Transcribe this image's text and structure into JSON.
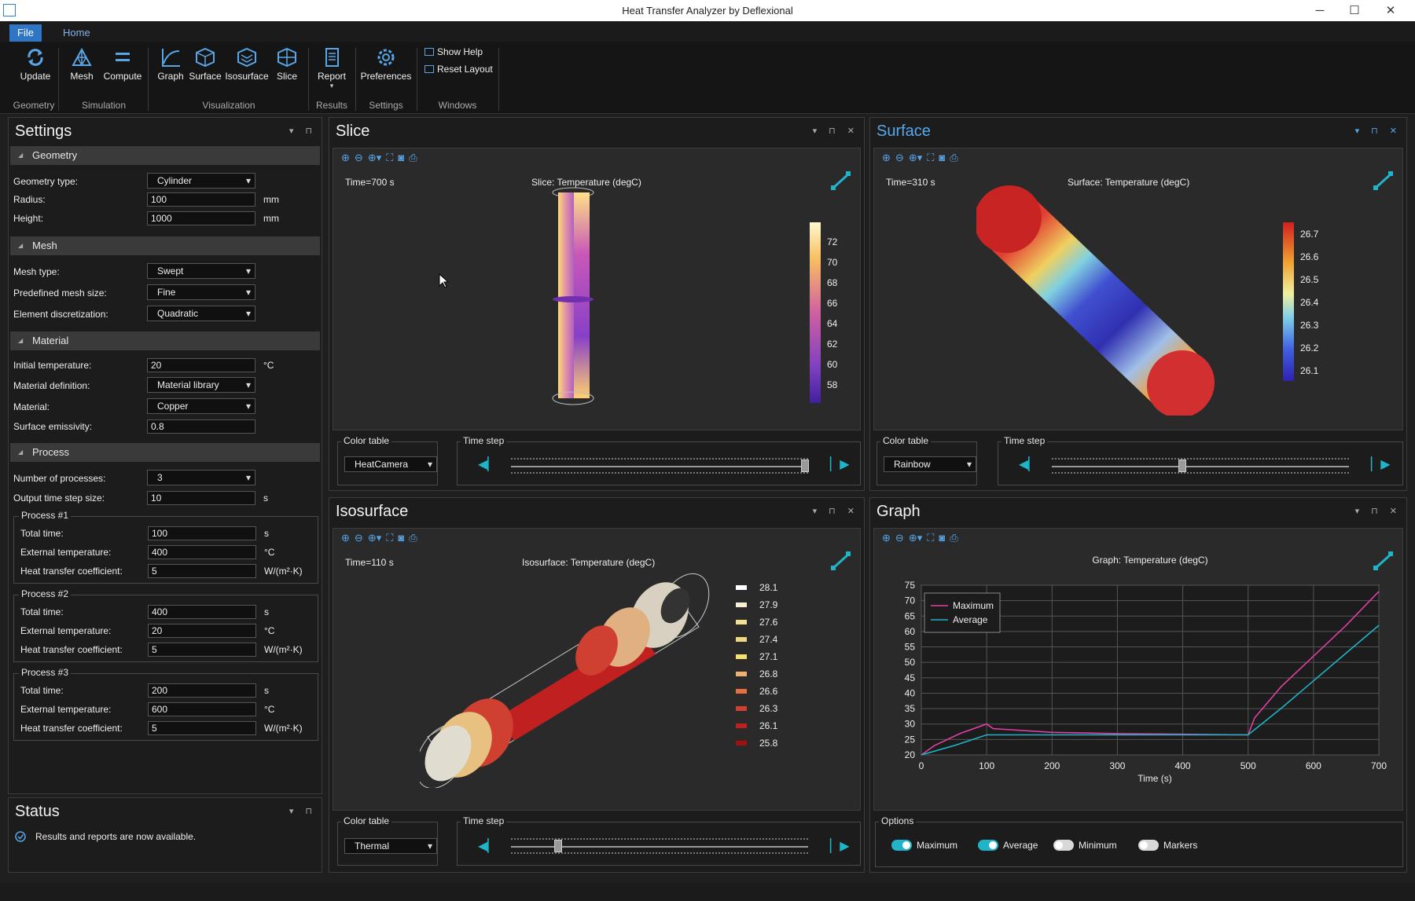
{
  "window": {
    "title": "Heat Transfer Analyzer by Deflexional",
    "minimize": "─",
    "maximize": "☐",
    "close": "✕"
  },
  "ribbon": {
    "tabs": [
      "File",
      "Home"
    ],
    "buttons": {
      "update": "Update",
      "mesh": "Mesh",
      "compute": "Compute",
      "graph": "Graph",
      "surface": "Surface",
      "isosurface": "Isosurface",
      "slice": "Slice",
      "report": "Report",
      "preferences": "Preferences"
    },
    "groups": {
      "geometry": "Geometry",
      "simulation": "Simulation",
      "visualization": "Visualization",
      "results": "Results",
      "settings": "Settings",
      "windows": "Windows"
    },
    "windows": {
      "show_help": "Show Help",
      "reset_layout": "Reset Layout"
    }
  },
  "settings": {
    "title": "Settings",
    "geometry": {
      "header": "Geometry",
      "type_label": "Geometry type:",
      "type_value": "Cylinder",
      "radius_label": "Radius:",
      "radius_value": "100",
      "radius_unit": "mm",
      "height_label": "Height:",
      "height_value": "1000",
      "height_unit": "mm"
    },
    "mesh": {
      "header": "Mesh",
      "type_label": "Mesh type:",
      "type_value": "Swept",
      "size_label": "Predefined mesh size:",
      "size_value": "Fine",
      "disc_label": "Element discretization:",
      "disc_value": "Quadratic"
    },
    "material": {
      "header": "Material",
      "init_temp_label": "Initial temperature:",
      "init_temp_value": "20",
      "init_temp_unit": "°C",
      "def_label": "Material definition:",
      "def_value": "Material library",
      "material_label": "Material:",
      "material_value": "Copper",
      "emissivity_label": "Surface emissivity:",
      "emissivity_value": "0.8"
    },
    "process": {
      "header": "Process",
      "count_label": "Number of processes:",
      "count_value": "3",
      "step_label": "Output time step size:",
      "step_value": "10",
      "step_unit": "s",
      "items": [
        {
          "title": "Process #1",
          "total_label": "Total time:",
          "total_value": "100",
          "total_unit": "s",
          "ext_label": "External temperature:",
          "ext_value": "400",
          "ext_unit": "°C",
          "htc_label": "Heat transfer coefficient:",
          "htc_value": "5",
          "htc_unit": "W/(m²·K)"
        },
        {
          "title": "Process #2",
          "total_label": "Total time:",
          "total_value": "400",
          "total_unit": "s",
          "ext_label": "External temperature:",
          "ext_value": "20",
          "ext_unit": "°C",
          "htc_label": "Heat transfer coefficient:",
          "htc_value": "5",
          "htc_unit": "W/(m²·K)"
        },
        {
          "title": "Process #3",
          "total_label": "Total time:",
          "total_value": "200",
          "total_unit": "s",
          "ext_label": "External temperature:",
          "ext_value": "600",
          "ext_unit": "°C",
          "htc_label": "Heat transfer coefficient:",
          "htc_value": "5",
          "htc_unit": "W/(m²·K)"
        }
      ]
    }
  },
  "status": {
    "title": "Status",
    "message": "Results and reports are now available."
  },
  "slice": {
    "title": "Slice",
    "time": "Time=700 s",
    "plot_title": "Slice: Temperature (degC)",
    "legend": [
      "72",
      "70",
      "68",
      "66",
      "64",
      "62",
      "60",
      "58"
    ],
    "color_table_label": "Color table",
    "color_table": "HeatCamera",
    "time_step_label": "Time step",
    "time_step_fraction": 0.99
  },
  "surface": {
    "title": "Surface",
    "time": "Time=310 s",
    "plot_title": "Surface: Temperature (degC)",
    "legend": [
      "26.7",
      "26.6",
      "26.5",
      "26.4",
      "26.3",
      "26.2",
      "26.1"
    ],
    "color_table_label": "Color table",
    "color_table": "Rainbow",
    "time_step_label": "Time step",
    "time_step_fraction": 0.44
  },
  "isosurface": {
    "title": "Isosurface",
    "time": "Time=110 s",
    "plot_title": "Isosurface: Temperature (degC)",
    "legend": [
      "28.1",
      "27.9",
      "27.6",
      "27.4",
      "27.1",
      "26.8",
      "26.6",
      "26.3",
      "26.1",
      "25.8"
    ],
    "color_table_label": "Color table",
    "color_table": "Thermal",
    "time_step_label": "Time step",
    "time_step_fraction": 0.16
  },
  "graph": {
    "title": "Graph",
    "options_label": "Options",
    "options": [
      {
        "label": "Maximum",
        "on": true
      },
      {
        "label": "Average",
        "on": true
      },
      {
        "label": "Minimum",
        "on": false
      },
      {
        "label": "Markers",
        "on": false
      }
    ]
  },
  "chart_data": {
    "type": "line",
    "title": "Graph: Temperature (degC)",
    "xlabel": "Time (s)",
    "ylabel": "",
    "xlim": [
      0,
      700
    ],
    "ylim": [
      20,
      75
    ],
    "xticks": [
      "0",
      "100",
      "200",
      "300",
      "400",
      "500",
      "600",
      "700"
    ],
    "yticks": [
      "75",
      "70",
      "65",
      "60",
      "55",
      "50",
      "45",
      "40",
      "35",
      "30",
      "25",
      "20"
    ],
    "grid": true,
    "legend_position": "top-left",
    "series": [
      {
        "name": "Maximum",
        "color": "#e040a0",
        "x": [
          0,
          20,
          60,
          100,
          110,
          200,
          300,
          400,
          500,
          510,
          550,
          600,
          650,
          700
        ],
        "y": [
          20,
          23,
          27,
          30,
          28.5,
          27.3,
          26.9,
          26.7,
          26.5,
          32,
          42,
          52,
          62,
          73
        ]
      },
      {
        "name": "Average",
        "color": "#1fb4c8",
        "x": [
          0,
          50,
          100,
          200,
          300,
          400,
          500,
          550,
          600,
          650,
          700
        ],
        "y": [
          20,
          23,
          26.5,
          26.5,
          26.5,
          26.5,
          26.5,
          35,
          44,
          53,
          62
        ]
      }
    ]
  }
}
